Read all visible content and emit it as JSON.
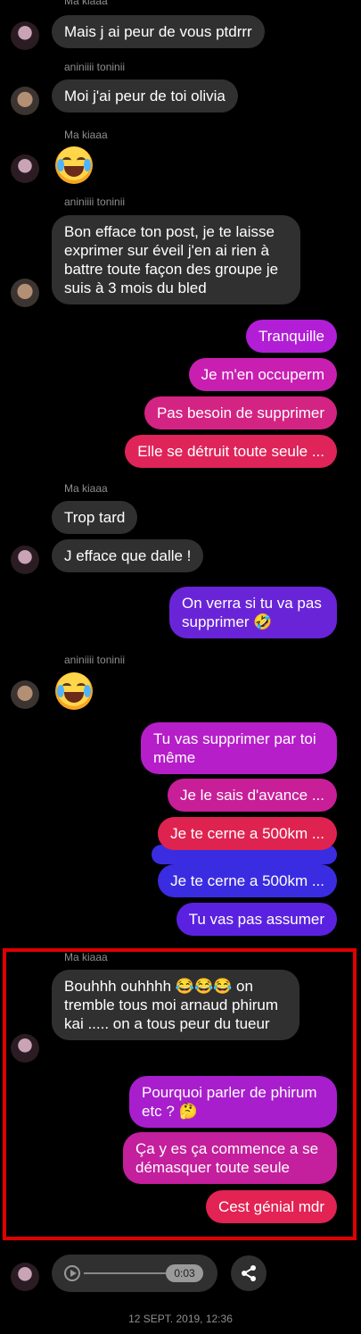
{
  "messages": [
    {
      "id": "m1",
      "type": "sender",
      "text": "Ma kiaaa"
    },
    {
      "id": "m2",
      "type": "recv",
      "text": "Mais j ai peur de vous ptdrrr"
    },
    {
      "id": "m3",
      "type": "sender",
      "text": "aniniiii toninii"
    },
    {
      "id": "m4",
      "type": "recv",
      "text": "Moi j'ai peur de toi olivia"
    },
    {
      "id": "m5",
      "type": "sender",
      "text": "Ma kiaaa"
    },
    {
      "id": "m6",
      "type": "sender",
      "text": "aniniiii toninii"
    },
    {
      "id": "m7",
      "type": "recv",
      "text": "Bon efface ton post, je te laisse exprimer sur éveil j'en ai rien à battre toute façon des groupe je suis à 3 mois du bled"
    },
    {
      "id": "m8",
      "type": "sent",
      "text": "Tranquille"
    },
    {
      "id": "m9",
      "type": "sent",
      "text": "Je m'en occuperm"
    },
    {
      "id": "m10",
      "type": "sent",
      "text": "Pas besoin de supprimer"
    },
    {
      "id": "m11",
      "type": "sent",
      "text": "Elle se détruit toute seule ..."
    },
    {
      "id": "m12",
      "type": "sender",
      "text": "Ma kiaaa"
    },
    {
      "id": "m13",
      "type": "recv",
      "text": "Trop tard"
    },
    {
      "id": "m14",
      "type": "recv",
      "text": "J efface que dalle !"
    },
    {
      "id": "m15",
      "type": "sent",
      "text": "On verra si tu va pas supprimer 🤣"
    },
    {
      "id": "m16",
      "type": "sender",
      "text": "aniniiii toninii"
    },
    {
      "id": "m17",
      "type": "sent",
      "text": "Tu vas supprimer par toi même"
    },
    {
      "id": "m18",
      "type": "sent",
      "text": "Je le sais d'avance ..."
    },
    {
      "id": "m19",
      "type": "sent",
      "text": "Je te cerne a 500km ..."
    },
    {
      "id": "m20",
      "type": "sent",
      "text": "Je te cerne a 500km ..."
    },
    {
      "id": "m21",
      "type": "sent",
      "text": "Tu vas pas assumer"
    },
    {
      "id": "m22",
      "type": "sender",
      "text": "Ma kiaaa"
    },
    {
      "id": "m23",
      "type": "recv",
      "text": "Bouhhh ouhhhh 😂😂😂 on tremble tous moi arnaud phirum kai ..... on a tous peur du tueur"
    },
    {
      "id": "m24",
      "type": "sent",
      "text": "Pourquoi parler de phirum etc ? 🤔"
    },
    {
      "id": "m25",
      "type": "sent",
      "text": "Ça y es ça commence a se démasquer toute seule"
    },
    {
      "id": "m26",
      "type": "sent",
      "text": "Cest génial mdr"
    }
  ],
  "voice": {
    "duration": "0:03"
  },
  "footer": {
    "timestamp": "12 SEPT. 2019, 12:36"
  },
  "icons": {
    "share": "share-icon",
    "play": "play-icon"
  },
  "colors": {
    "highlight": "#e00000",
    "received": "#303030"
  }
}
